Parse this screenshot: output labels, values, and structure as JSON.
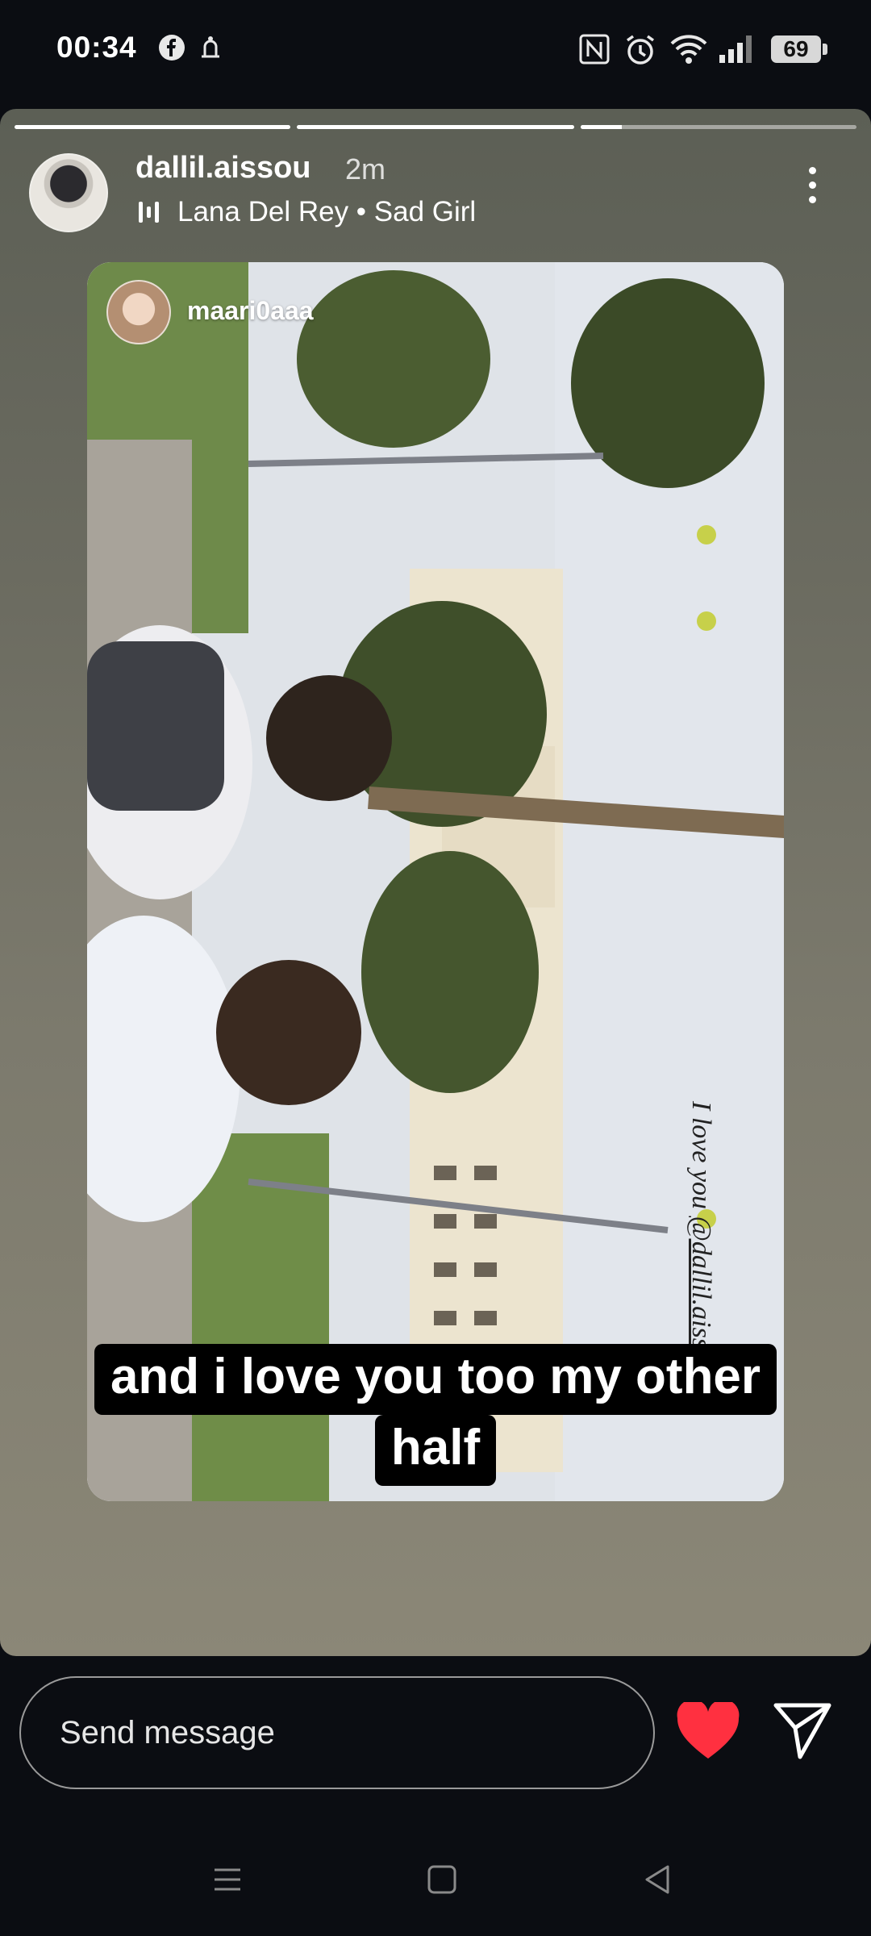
{
  "status_bar": {
    "time": "00:34",
    "battery": "69",
    "icons": [
      "facebook-icon",
      "notification-icon",
      "nfc-icon",
      "alarm-icon",
      "wifi-icon",
      "signal-icon",
      "battery-icon"
    ]
  },
  "story": {
    "progress_segments": 3,
    "username": "dallil.aissou",
    "time_ago": "2m",
    "music": "Lana Del Rey • Sad Girl"
  },
  "shared_post": {
    "username": "maari0aaa",
    "caption_prefix": "I love you ",
    "caption_mention": "@dallil.aissou",
    "overlay_line1": "and i love you too my other",
    "overlay_line2": "half"
  },
  "bottom_bar": {
    "message_placeholder": "Send message",
    "heart_color": "#ff3040"
  },
  "nav_bar": {
    "items": [
      "menu-icon",
      "home-icon",
      "back-icon"
    ]
  }
}
